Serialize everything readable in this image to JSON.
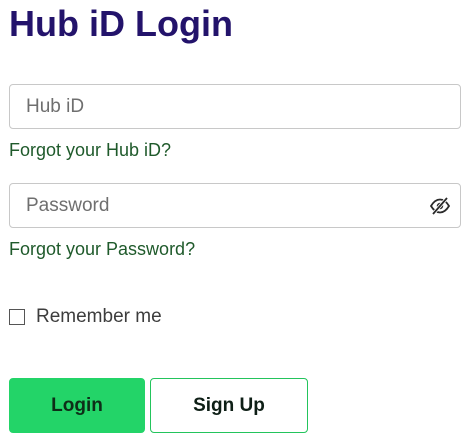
{
  "page": {
    "title": "Hub iD Login"
  },
  "form": {
    "hubid_placeholder": "Hub iD",
    "forgot_hubid_label": "Forgot your Hub iD?",
    "password_placeholder": "Password",
    "forgot_password_label": "Forgot your Password?",
    "remember_label": "Remember me",
    "remember_checked": false,
    "password_visibility_icon": "eye-slash-icon"
  },
  "buttons": {
    "login_label": "Login",
    "signup_label": "Sign Up"
  },
  "colors": {
    "title": "#23136b",
    "link": "#1f5a2b",
    "login_bg": "#23d468",
    "signup_border": "#23c45c"
  }
}
